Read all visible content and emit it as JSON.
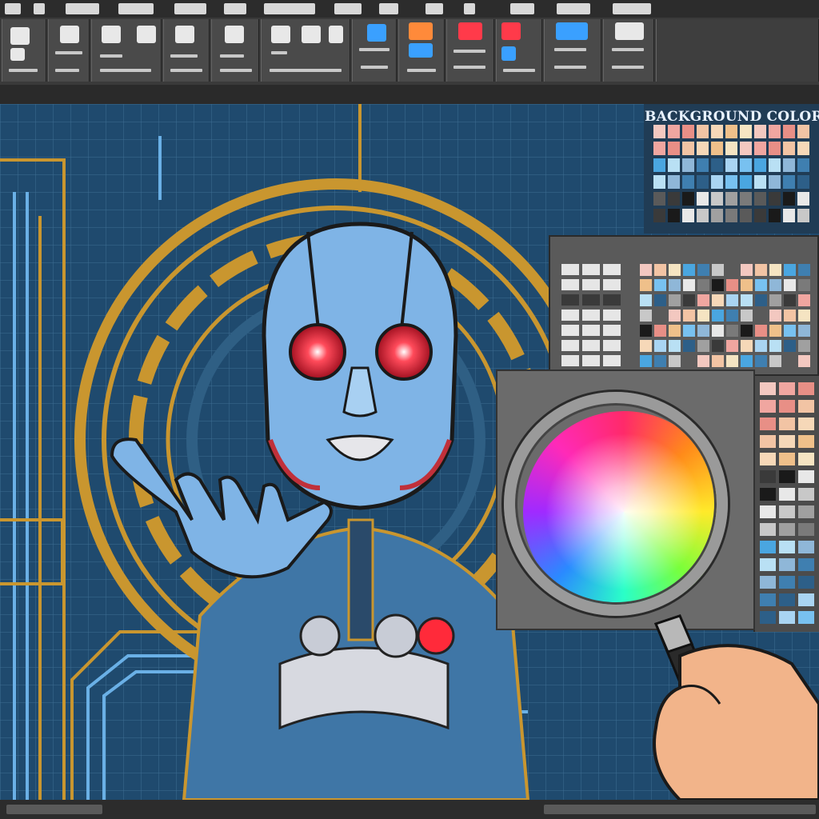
{
  "background_color_panel": {
    "title": "BACKGROUND COLOR"
  },
  "color_picker": {
    "icon": "color-wheel-magnifier-icon"
  },
  "artwork": {
    "subject_icon": "robot-figure-icon"
  },
  "colors": {
    "canvas_blue": "#1f4a6e",
    "grid_line": "#3d6d93",
    "gold": "#c9962f",
    "robot_face": "#7fb4e6",
    "eye_red": "#ff2a3a",
    "toolbar_dark": "#3a3a3a"
  }
}
